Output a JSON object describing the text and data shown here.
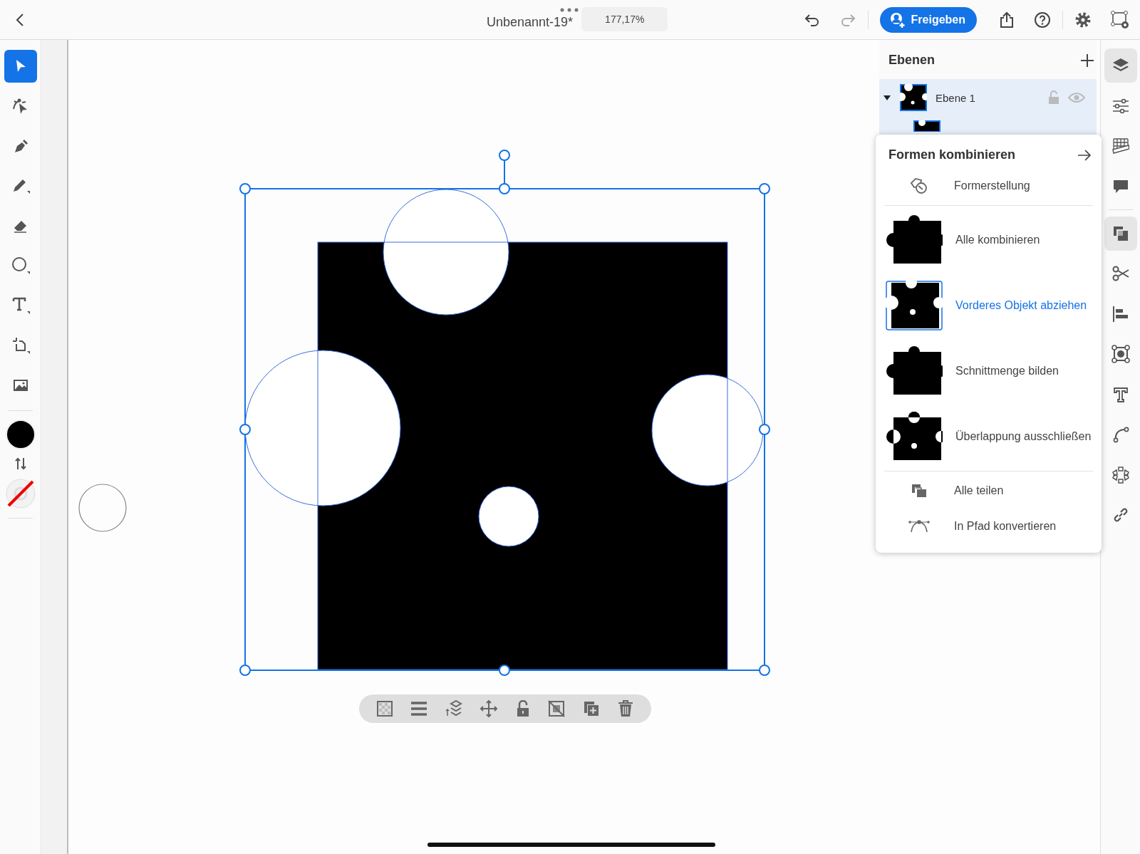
{
  "top_bar": {
    "title": "Unbenannt-19*",
    "zoom": "177,17%",
    "share_button": "Freigeben"
  },
  "tools": [
    {
      "kind": "select",
      "selected": true
    },
    {
      "kind": "direct",
      "selected": false
    },
    {
      "kind": "pen",
      "selected": false
    },
    {
      "kind": "pencil",
      "selected": false
    },
    {
      "kind": "eraser",
      "selected": false
    },
    {
      "kind": "ellipse",
      "selected": false
    },
    {
      "kind": "type",
      "selected": false
    },
    {
      "kind": "artboard",
      "selected": false
    },
    {
      "kind": "image",
      "selected": false
    }
  ],
  "layers": {
    "title": "Ebenen",
    "rows": [
      {
        "name": "Ebene 1",
        "expanded": true,
        "selected": true
      }
    ]
  },
  "combine_menu": {
    "title": "Formen kombinieren",
    "items": [
      {
        "kind": "builder",
        "label": "Formerstellung",
        "selected": false
      },
      {
        "kind": "unite",
        "label": "Alle kombinieren",
        "selected": false
      },
      {
        "kind": "minus_front",
        "label": "Vorderes Objekt abziehen",
        "selected": true
      },
      {
        "kind": "intersect",
        "label": "Schnittmenge bilden",
        "selected": false
      },
      {
        "kind": "exclude",
        "label": "Überlappung ausschließen",
        "selected": false
      },
      {
        "kind": "divide",
        "label": "Alle teilen",
        "selected": false
      },
      {
        "kind": "convert",
        "label": "In Pfad konvertieren",
        "selected": false
      }
    ]
  },
  "right_rail": [
    {
      "kind": "layers",
      "selected": true
    },
    {
      "kind": "properties",
      "selected": false
    },
    {
      "kind": "grid",
      "selected": false
    },
    {
      "kind": "comments",
      "selected": false
    },
    {
      "kind": "combine",
      "selected": true
    },
    {
      "kind": "cut",
      "selected": false
    },
    {
      "kind": "align",
      "selected": false
    },
    {
      "kind": "transform",
      "selected": false
    },
    {
      "kind": "type",
      "selected": false
    },
    {
      "kind": "path",
      "selected": false
    },
    {
      "kind": "repeat",
      "selected": false
    },
    {
      "kind": "link",
      "selected": false
    }
  ]
}
